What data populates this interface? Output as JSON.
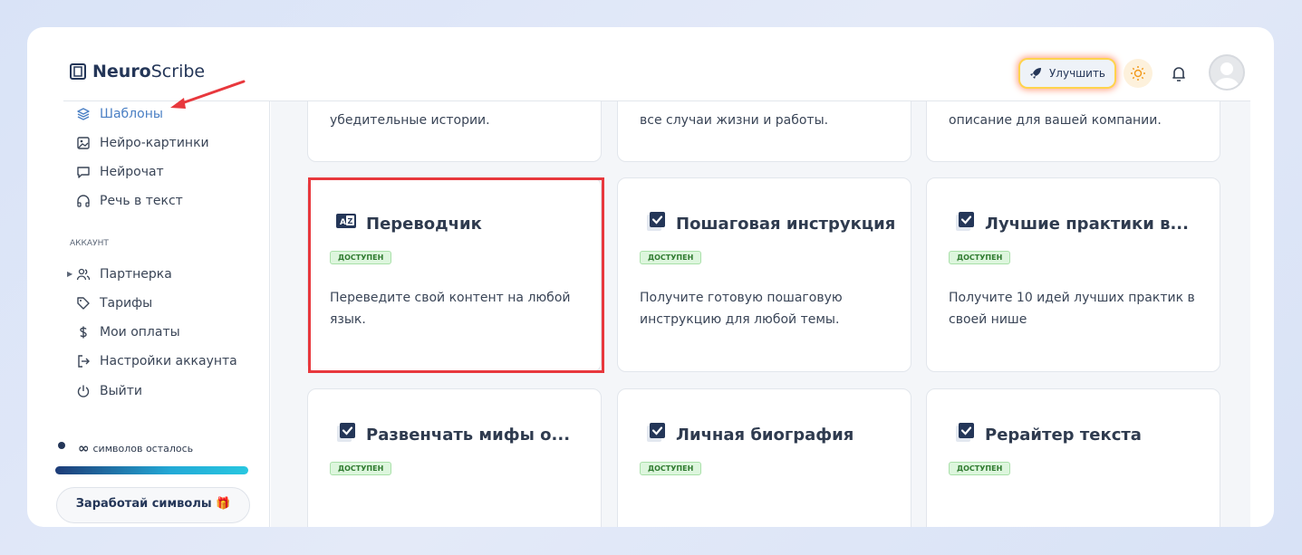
{
  "app": {
    "logo_bold": "Neuro",
    "logo_light": "Scribe"
  },
  "header": {
    "upgrade_label": "Улучшить"
  },
  "sidebar": {
    "items": [
      {
        "label": "Шаблоны"
      },
      {
        "label": "Нейро-картинки"
      },
      {
        "label": "Нейрочат"
      },
      {
        "label": "Речь в текст"
      }
    ],
    "section_label": "АККАУНТ",
    "account_items": [
      {
        "label": "Партнерка"
      },
      {
        "label": "Тарифы"
      },
      {
        "label": "Мои оплаты"
      },
      {
        "label": "Настройки аккаунта"
      },
      {
        "label": "Выйти"
      }
    ],
    "symbols_remaining_value": "∞",
    "symbols_remaining_label": "символов осталось",
    "earn_label": "Заработай символы 🎁"
  },
  "cards": {
    "top_row": [
      {
        "desc": "убедительные истории."
      },
      {
        "desc": "все случаи жизни и работы."
      },
      {
        "desc": "описание для вашей компании."
      }
    ],
    "middle_row": [
      {
        "title": "Переводчик",
        "badge": "ДОСТУПЕН",
        "desc": "Переведите свой контент на любой язык."
      },
      {
        "title": "Пошаговая инструкция",
        "badge": "ДОСТУПЕН",
        "desc": "Получите готовую пошаговую инструкцию для любой темы."
      },
      {
        "title": "Лучшие практики в...",
        "badge": "ДОСТУПЕН",
        "desc": "Получите 10 идей лучших практик в своей нише"
      }
    ],
    "bottom_row": [
      {
        "title": "Развенчать мифы о...",
        "badge": "ДОСТУПЕН"
      },
      {
        "title": "Личная биография",
        "badge": "ДОСТУПЕН"
      },
      {
        "title": "Рерайтер текста",
        "badge": "ДОСТУПЕН"
      }
    ]
  },
  "colors": {
    "accent": "#4a7fc4",
    "brand": "#243658",
    "badge_bg": "#ddf6dd",
    "highlight": "#e8383d"
  }
}
